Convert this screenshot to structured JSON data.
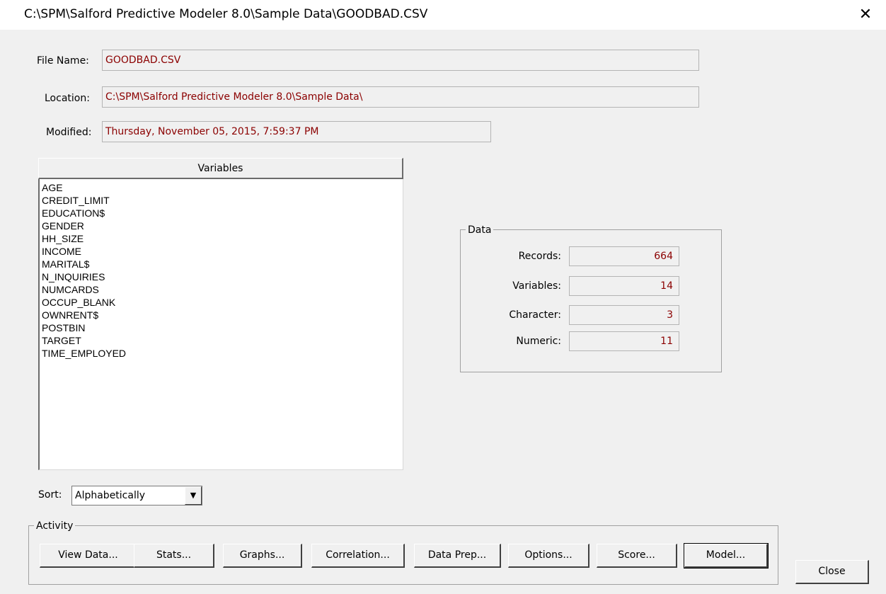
{
  "window": {
    "title": "C:\\SPM\\Salford Predictive Modeler 8.0\\Sample Data\\GOODBAD.CSV",
    "close_glyph": "✕"
  },
  "file_info": {
    "file_name_label": "File Name:",
    "file_name_value": "GOODBAD.CSV",
    "location_label": "Location:",
    "location_value": "C:\\SPM\\Salford Predictive Modeler 8.0\\Sample Data\\",
    "modified_label": "Modified:",
    "modified_value": "Thursday, November 05, 2015, 7:59:37 PM"
  },
  "variables": {
    "header": "Variables",
    "items": [
      "AGE",
      "CREDIT_LIMIT",
      "EDUCATION$",
      "GENDER",
      "HH_SIZE",
      "INCOME",
      "MARITAL$",
      "N_INQUIRIES",
      "NUMCARDS",
      "OCCUP_BLANK",
      "OWNRENT$",
      "POSTBIN",
      "TARGET",
      "TIME_EMPLOYED"
    ]
  },
  "data_group": {
    "title": "Data",
    "records_label": "Records:",
    "records_value": "664",
    "variables_label": "Variables:",
    "variables_value": "14",
    "character_label": "Character:",
    "character_value": "3",
    "numeric_label": "Numeric:",
    "numeric_value": "11"
  },
  "sort": {
    "label": "Sort:",
    "selected": "Alphabetically",
    "arrow_glyph": "▼"
  },
  "activity": {
    "title": "Activity",
    "buttons": {
      "view_data": "View Data...",
      "stats": "Stats...",
      "graphs": "Graphs...",
      "correlation": "Correlation...",
      "data_prep": "Data Prep...",
      "options": "Options...",
      "score": "Score...",
      "model": "Model..."
    }
  },
  "close_button": "Close"
}
